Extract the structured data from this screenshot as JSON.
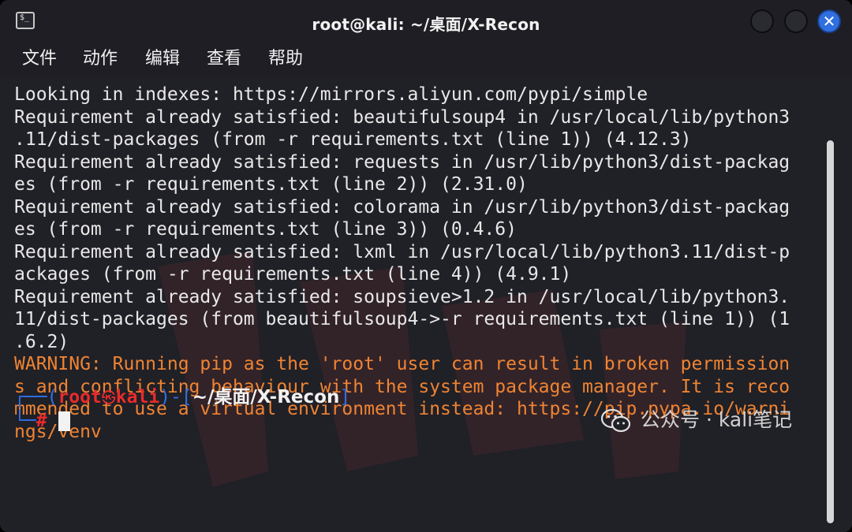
{
  "window": {
    "title": "root@kali: ~/桌面/X-Recon",
    "app_icon_glyph": "$_",
    "close_glyph": "✕"
  },
  "menu": [
    "文件",
    "动作",
    "编辑",
    "查看",
    "帮助"
  ],
  "terminal_lines": [
    {
      "text": "Looking in indexes: https://mirrors.aliyun.com/pypi/simple",
      "style": "normal"
    },
    {
      "text": "Requirement already satisfied: beautifulsoup4 in /usr/local/lib/python3",
      "style": "normal"
    },
    {
      "text": ".11/dist-packages (from -r requirements.txt (line 1)) (4.12.3)",
      "style": "normal"
    },
    {
      "text": "Requirement already satisfied: requests in /usr/lib/python3/dist-packag",
      "style": "normal"
    },
    {
      "text": "es (from -r requirements.txt (line 2)) (2.31.0)",
      "style": "normal"
    },
    {
      "text": "Requirement already satisfied: colorama in /usr/lib/python3/dist-packag",
      "style": "normal"
    },
    {
      "text": "es (from -r requirements.txt (line 3)) (0.4.6)",
      "style": "normal"
    },
    {
      "text": "Requirement already satisfied: lxml in /usr/local/lib/python3.11/dist-p",
      "style": "normal"
    },
    {
      "text": "ackages (from -r requirements.txt (line 4)) (4.9.1)",
      "style": "normal"
    },
    {
      "text": "Requirement already satisfied: soupsieve>1.2 in /usr/local/lib/python3.",
      "style": "normal"
    },
    {
      "text": "11/dist-packages (from beautifulsoup4->-r requirements.txt (line 1)) (1",
      "style": "normal"
    },
    {
      "text": ".6.2)",
      "style": "normal"
    },
    {
      "text": "WARNING: Running pip as the 'root' user can result in broken permission",
      "style": "warn"
    },
    {
      "text": "s and conflicting behaviour with the system package manager. It is reco",
      "style": "warn"
    },
    {
      "text": "mmended to use a virtual environment instead: https://pip.pypa.io/warni",
      "style": "warn"
    },
    {
      "text": "ngs/venv",
      "style": "warn"
    }
  ],
  "prompt": {
    "open": "┌──(",
    "user": "root",
    "skull": "㉿",
    "host": "kali",
    "mid": ")-[",
    "dir": "~/桌面/X-Recon",
    "close": "]",
    "line2_prefix": "└─",
    "symbol": "#"
  },
  "watermark": {
    "text": "公众号 · kali笔记",
    "icon": "wechat-icon"
  },
  "colors": {
    "warning": "#ef8432",
    "prompt_user": "#ea2b2b",
    "prompt_frame": "#2f6fe8",
    "close_button": "#2f6fe0"
  }
}
